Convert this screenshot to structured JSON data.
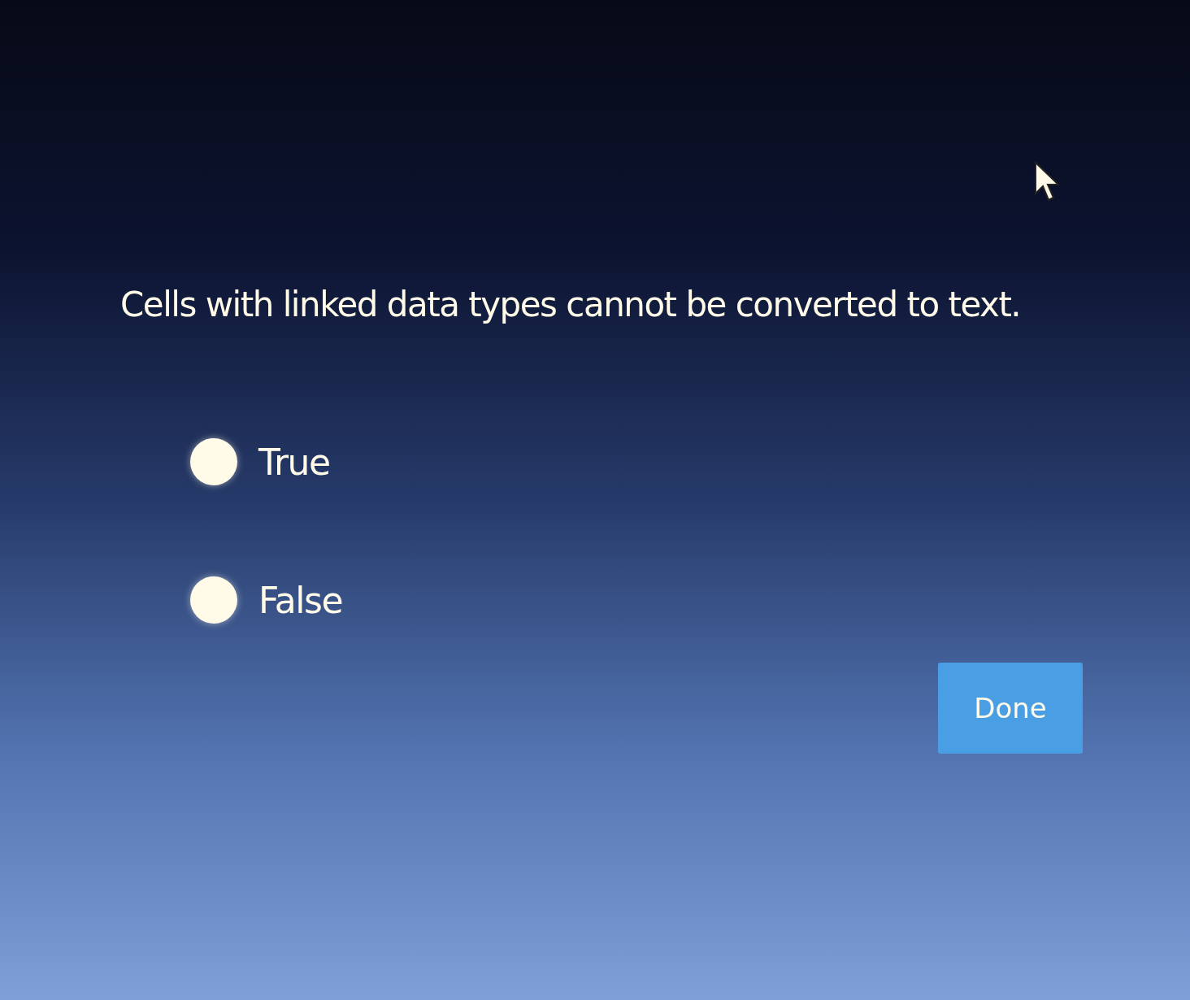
{
  "question": "Cells with linked data types cannot be converted to text.",
  "options": [
    {
      "label": "True",
      "selected": false
    },
    {
      "label": "False",
      "selected": false
    }
  ],
  "button": "Done"
}
